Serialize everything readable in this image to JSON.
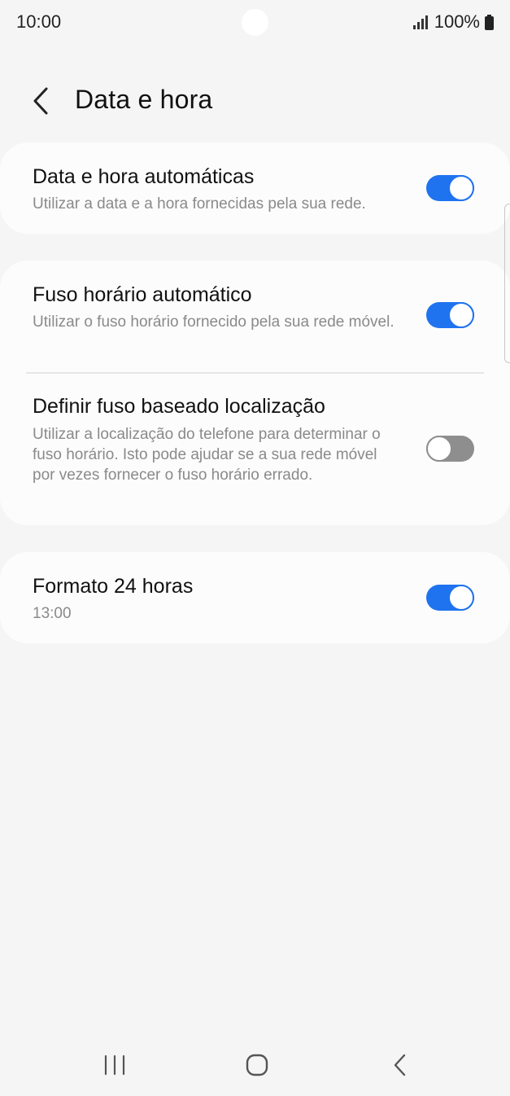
{
  "status_bar": {
    "time": "10:00",
    "battery_text": "100%",
    "signal_icon": "signal-bars-icon",
    "battery_icon": "battery-full-icon"
  },
  "header": {
    "back_icon": "chevron-left-icon",
    "title": "Data e hora"
  },
  "settings": {
    "auto_datetime": {
      "title": "Data e hora automáticas",
      "description": "Utilizar a data e a hora fornecidas pela sua rede.",
      "enabled": true
    },
    "auto_timezone": {
      "title": "Fuso horário automático",
      "description": "Utilizar o fuso horário fornecido pela sua rede móvel.",
      "enabled": true
    },
    "location_timezone": {
      "title": "Definir fuso baseado localização",
      "description": "Utilizar a localização do telefone para determinar o fuso horário. Isto pode ajudar se a sua rede móvel por vezes fornecer o fuso horário errado.",
      "enabled": false
    },
    "format_24h": {
      "title": "Formato 24 horas",
      "description": "13:00",
      "enabled": true
    }
  },
  "colors": {
    "toggle_on": "#1f73ef",
    "toggle_off": "#8e8e8e",
    "background": "#f5f5f5",
    "card": "#fcfcfc"
  },
  "nav_bar": {
    "recent_icon": "recent-apps-icon",
    "home_icon": "home-icon",
    "back_icon": "back-icon"
  }
}
